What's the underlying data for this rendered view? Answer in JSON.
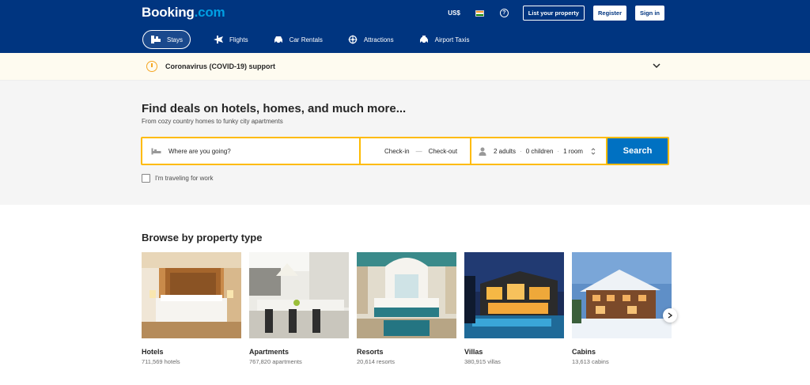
{
  "header": {
    "logo_main": "Booking",
    "logo_suffix": ".com",
    "currency": "US$",
    "list_property": "List your property",
    "register": "Register",
    "sign_in": "Sign in"
  },
  "nav": [
    {
      "label": "Stays",
      "icon": "bed-icon",
      "active": true
    },
    {
      "label": "Flights",
      "icon": "plane-icon"
    },
    {
      "label": "Car Rentals",
      "icon": "car-icon"
    },
    {
      "label": "Attractions",
      "icon": "attractions-icon"
    },
    {
      "label": "Airport Taxis",
      "icon": "taxi-icon"
    }
  ],
  "covid": {
    "text": "Coronavirus (COVID-19) support"
  },
  "hero": {
    "title": "Find deals on hotels, homes, and much more...",
    "subtitle": "From cozy country homes to funky city apartments"
  },
  "search": {
    "destination_placeholder": "Where are you going?",
    "check_in": "Check-in",
    "check_out": "Check-out",
    "dash": "—",
    "adults": "2 adults",
    "children": "0 children",
    "rooms": "1 room",
    "dot": "·",
    "button": "Search"
  },
  "work": {
    "label": "I'm traveling for work"
  },
  "browse": {
    "title": "Browse by property type",
    "items": [
      {
        "name": "Hotels",
        "count": "711,569 hotels"
      },
      {
        "name": "Apartments",
        "count": "767,820 apartments"
      },
      {
        "name": "Resorts",
        "count": "20,614 resorts"
      },
      {
        "name": "Villas",
        "count": "380,915 villas"
      },
      {
        "name": "Cabins",
        "count": "13,613 cabins"
      }
    ]
  },
  "colors": {
    "brand_blue": "#003580",
    "search_yellow": "#febb02",
    "button_blue": "#0071c2"
  }
}
